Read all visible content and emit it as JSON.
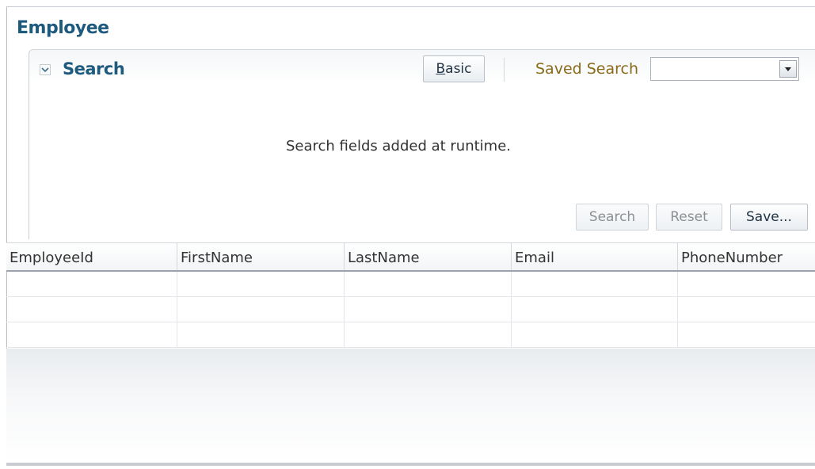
{
  "page": {
    "title": "Employee"
  },
  "search_panel": {
    "title": "Search",
    "basic_button": {
      "mnemonic": "B",
      "rest": "asic"
    },
    "saved_search_label": "Saved Search",
    "saved_search_value": "",
    "message": "Search fields added at runtime.",
    "buttons": {
      "search": "Search",
      "reset": "Reset",
      "save": "Save..."
    }
  },
  "table": {
    "columns": [
      "EmployeeId",
      "FirstName",
      "LastName",
      "Email",
      "PhoneNumber"
    ],
    "rows": [
      [
        "",
        "",
        "",
        "",
        ""
      ],
      [
        "",
        "",
        "",
        "",
        ""
      ],
      [
        "",
        "",
        "",
        "",
        ""
      ]
    ]
  },
  "colors": {
    "title": "#1e5a7e",
    "saved_search_label": "#8a6a1a"
  }
}
